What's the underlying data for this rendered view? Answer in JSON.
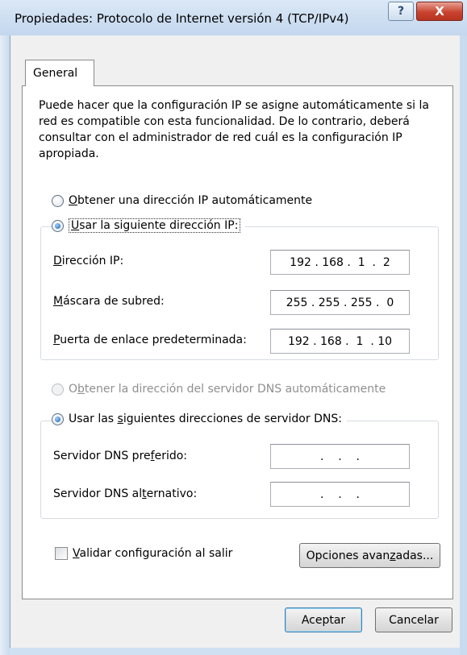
{
  "window": {
    "title": "Propiedades: Protocolo de Internet versión 4 (TCP/IPv4)",
    "help_glyph": "?",
    "close_glyph": "X"
  },
  "tabs": [
    {
      "label": "General",
      "selected": true
    }
  ],
  "intro_text": "Puede hacer que la configuración IP se asigne automáticamente si la red es compatible con esta funcionalidad. De lo contrario, deberá consultar con el administrador de red cuál es la configuración IP apropiada.",
  "ip_section": {
    "auto_option": {
      "mnemonic": "O",
      "label_rest": "btener una dirección IP automáticamente",
      "selected": false
    },
    "manual_option": {
      "mnemonic": "U",
      "label_rest": "sar la siguiente dirección IP:",
      "selected": true
    },
    "fields": [
      {
        "mnemonic": "D",
        "label_rest": "irección IP:",
        "value": "192 . 168 .  1  .  2"
      },
      {
        "mnemonic": "M",
        "label_rest": "áscara de subred:",
        "value": "255 . 255 . 255 .  0"
      },
      {
        "mnemonic": "P",
        "label_rest": "uerta de enlace predeterminada:",
        "value": "192 . 168 .  1  . 10"
      }
    ]
  },
  "dns_section": {
    "auto_option": {
      "label_pre": "O",
      "mnemonic": "b",
      "label_post": "tener la dirección del servidor DNS automáticamente",
      "enabled": false,
      "selected": false
    },
    "manual_option": {
      "label_pre": "Usar las ",
      "mnemonic": "s",
      "label_post": "iguientes direcciones de servidor DNS:",
      "selected": true
    },
    "fields": [
      {
        "label_pre": "Servidor DNS pre",
        "mnemonic": "f",
        "label_post": "erido:",
        "value": "  .    .    .  "
      },
      {
        "label_pre": "Servidor DNS al",
        "mnemonic": "t",
        "label_post": "ernativo:",
        "value": "  .    .    .  "
      }
    ]
  },
  "validate": {
    "mnemonic": "V",
    "label_rest": "alidar configuración al salir",
    "checked": false
  },
  "buttons": {
    "advanced": {
      "label_pre": "Opciones avan",
      "mnemonic": "z",
      "label_post": "adas..."
    },
    "ok": "Aceptar",
    "cancel": "Cancelar"
  },
  "colors": {
    "title_bar": "#c3d7ee",
    "close_button": "#c8442f",
    "default_button_border": "#3c7fb1",
    "radio_dot": "#1d5ea8"
  }
}
